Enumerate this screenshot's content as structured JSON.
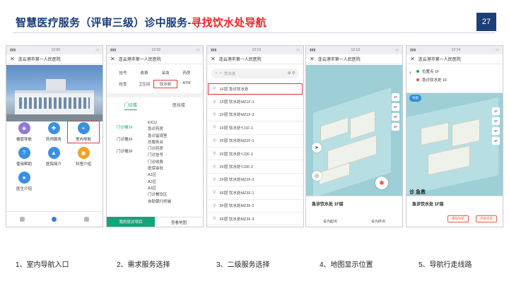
{
  "slide": {
    "title_main": "智慧医疗服务（评审三级）诊中服务-",
    "title_highlight": "寻找饮水处导航",
    "page_number": "27",
    "colors": {
      "title": "#1a3c78",
      "highlight": "#e8262a",
      "badge": "#1d3f76",
      "accent_green": "#14a37a"
    }
  },
  "captions": [
    "1、室内导航入口",
    "2、需求服务选择",
    "3、二级服务选择",
    "4、地图显示位置",
    "5、导航行走线路"
  ],
  "common": {
    "hospital": "连云港市第一人民医院",
    "close_icon": "close-icon",
    "status": [
      "12:00",
      "12:02",
      "12:13",
      "12:13",
      "12:14"
    ]
  },
  "phone1": {
    "services": [
      {
        "label": "楼层导航",
        "icon": "layers-icon",
        "color": "#8e7ad6"
      },
      {
        "label": "药师服务",
        "icon": "pill-icon",
        "color": "#3b8fe4"
      },
      {
        "label": "室内导航",
        "icon": "map-icon",
        "color": "#3b8fe4",
        "highlighted": true
      },
      {
        "label": "使用帮助",
        "icon": "help-icon",
        "color": "#3b8fe4"
      },
      {
        "label": "医院简介",
        "icon": "hospital-icon",
        "color": "#3b8fe4"
      },
      {
        "label": "科室介绍",
        "icon": "dept-icon",
        "color": "#f1a22a"
      },
      {
        "label": "医生介绍",
        "icon": "doctor-icon",
        "color": "#3b8fe4"
      }
    ],
    "tabs": [
      "",
      "",
      ""
    ]
  },
  "phone2": {
    "categories": [
      "挂号",
      "收费",
      "采血",
      "药房",
      "检查",
      "卫生间",
      "饮水处",
      "ATM"
    ],
    "highlighted_category": 6,
    "building_tabs": [
      "门诊楼",
      "医技楼"
    ],
    "floors": [
      "门诊楼1F",
      "门诊楼2F",
      "门诊楼3F"
    ],
    "departments": [
      "EICU",
      "急诊药房",
      "急诊留观室",
      "总服务台",
      "门诊药房",
      "门诊挂号",
      "门诊收费",
      "医保审批",
      "A1区",
      "A2区",
      "A3区",
      "门诊餐饮区",
      "自助银行终端"
    ],
    "bottom_left": "我的就诊项目",
    "bottom_right": "查看地图"
  },
  "phone3": {
    "search_placeholder": "饮水处",
    "rows": [
      "1F层 急诊饮水处",
      "1F层 饮水处MZ1F-1",
      "1F层 饮水处MZ1F-2",
      "1F层 饮水处YJ1F-1",
      "2F层 饮水处MZ2F-1",
      "2F层 饮水处YJ2F-1",
      "2F层 饮水处YJ2F-2",
      "2F层 饮水处MZ2F-2",
      "3F层 饮水处MZ3F-1",
      "3F层 饮水处MZ3F-2",
      "3F层 饮水处MZ3F-3"
    ]
  },
  "phone4": {
    "place": "急诊饮水处 1F层",
    "place_sub": "",
    "floors": [
      "1F",
      "2F",
      "3F",
      "4F"
    ],
    "actions": [
      "设为起点",
      "设为终点"
    ]
  },
  "phone5": {
    "route": [
      "位置点 1F",
      "急诊饮水处 1F"
    ],
    "pills": [
      "导航",
      "",
      ""
    ],
    "floors": [
      "1F",
      "2F",
      "3F",
      "4F"
    ],
    "dest_label": "诊 急救",
    "place": "急诊饮水处 1F层",
    "buttons": [
      "模拟导航",
      "开始导航"
    ]
  }
}
